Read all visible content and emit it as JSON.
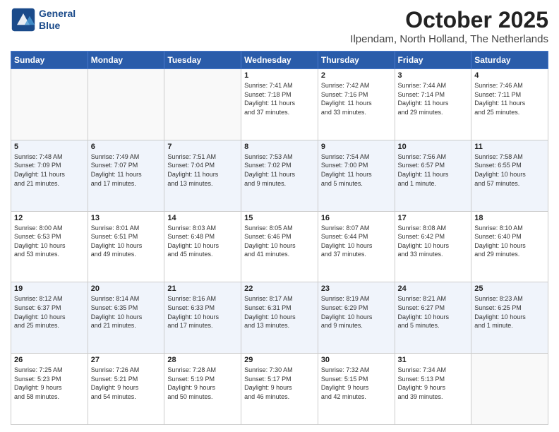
{
  "header": {
    "logo_line1": "General",
    "logo_line2": "Blue",
    "month": "October 2025",
    "location": "Ilpendam, North Holland, The Netherlands"
  },
  "days_of_week": [
    "Sunday",
    "Monday",
    "Tuesday",
    "Wednesday",
    "Thursday",
    "Friday",
    "Saturday"
  ],
  "weeks": [
    [
      {
        "day": "",
        "info": ""
      },
      {
        "day": "",
        "info": ""
      },
      {
        "day": "",
        "info": ""
      },
      {
        "day": "1",
        "info": "Sunrise: 7:41 AM\nSunset: 7:18 PM\nDaylight: 11 hours\nand 37 minutes."
      },
      {
        "day": "2",
        "info": "Sunrise: 7:42 AM\nSunset: 7:16 PM\nDaylight: 11 hours\nand 33 minutes."
      },
      {
        "day": "3",
        "info": "Sunrise: 7:44 AM\nSunset: 7:14 PM\nDaylight: 11 hours\nand 29 minutes."
      },
      {
        "day": "4",
        "info": "Sunrise: 7:46 AM\nSunset: 7:11 PM\nDaylight: 11 hours\nand 25 minutes."
      }
    ],
    [
      {
        "day": "5",
        "info": "Sunrise: 7:48 AM\nSunset: 7:09 PM\nDaylight: 11 hours\nand 21 minutes."
      },
      {
        "day": "6",
        "info": "Sunrise: 7:49 AM\nSunset: 7:07 PM\nDaylight: 11 hours\nand 17 minutes."
      },
      {
        "day": "7",
        "info": "Sunrise: 7:51 AM\nSunset: 7:04 PM\nDaylight: 11 hours\nand 13 minutes."
      },
      {
        "day": "8",
        "info": "Sunrise: 7:53 AM\nSunset: 7:02 PM\nDaylight: 11 hours\nand 9 minutes."
      },
      {
        "day": "9",
        "info": "Sunrise: 7:54 AM\nSunset: 7:00 PM\nDaylight: 11 hours\nand 5 minutes."
      },
      {
        "day": "10",
        "info": "Sunrise: 7:56 AM\nSunset: 6:57 PM\nDaylight: 11 hours\nand 1 minute."
      },
      {
        "day": "11",
        "info": "Sunrise: 7:58 AM\nSunset: 6:55 PM\nDaylight: 10 hours\nand 57 minutes."
      }
    ],
    [
      {
        "day": "12",
        "info": "Sunrise: 8:00 AM\nSunset: 6:53 PM\nDaylight: 10 hours\nand 53 minutes."
      },
      {
        "day": "13",
        "info": "Sunrise: 8:01 AM\nSunset: 6:51 PM\nDaylight: 10 hours\nand 49 minutes."
      },
      {
        "day": "14",
        "info": "Sunrise: 8:03 AM\nSunset: 6:48 PM\nDaylight: 10 hours\nand 45 minutes."
      },
      {
        "day": "15",
        "info": "Sunrise: 8:05 AM\nSunset: 6:46 PM\nDaylight: 10 hours\nand 41 minutes."
      },
      {
        "day": "16",
        "info": "Sunrise: 8:07 AM\nSunset: 6:44 PM\nDaylight: 10 hours\nand 37 minutes."
      },
      {
        "day": "17",
        "info": "Sunrise: 8:08 AM\nSunset: 6:42 PM\nDaylight: 10 hours\nand 33 minutes."
      },
      {
        "day": "18",
        "info": "Sunrise: 8:10 AM\nSunset: 6:40 PM\nDaylight: 10 hours\nand 29 minutes."
      }
    ],
    [
      {
        "day": "19",
        "info": "Sunrise: 8:12 AM\nSunset: 6:37 PM\nDaylight: 10 hours\nand 25 minutes."
      },
      {
        "day": "20",
        "info": "Sunrise: 8:14 AM\nSunset: 6:35 PM\nDaylight: 10 hours\nand 21 minutes."
      },
      {
        "day": "21",
        "info": "Sunrise: 8:16 AM\nSunset: 6:33 PM\nDaylight: 10 hours\nand 17 minutes."
      },
      {
        "day": "22",
        "info": "Sunrise: 8:17 AM\nSunset: 6:31 PM\nDaylight: 10 hours\nand 13 minutes."
      },
      {
        "day": "23",
        "info": "Sunrise: 8:19 AM\nSunset: 6:29 PM\nDaylight: 10 hours\nand 9 minutes."
      },
      {
        "day": "24",
        "info": "Sunrise: 8:21 AM\nSunset: 6:27 PM\nDaylight: 10 hours\nand 5 minutes."
      },
      {
        "day": "25",
        "info": "Sunrise: 8:23 AM\nSunset: 6:25 PM\nDaylight: 10 hours\nand 1 minute."
      }
    ],
    [
      {
        "day": "26",
        "info": "Sunrise: 7:25 AM\nSunset: 5:23 PM\nDaylight: 9 hours\nand 58 minutes."
      },
      {
        "day": "27",
        "info": "Sunrise: 7:26 AM\nSunset: 5:21 PM\nDaylight: 9 hours\nand 54 minutes."
      },
      {
        "day": "28",
        "info": "Sunrise: 7:28 AM\nSunset: 5:19 PM\nDaylight: 9 hours\nand 50 minutes."
      },
      {
        "day": "29",
        "info": "Sunrise: 7:30 AM\nSunset: 5:17 PM\nDaylight: 9 hours\nand 46 minutes."
      },
      {
        "day": "30",
        "info": "Sunrise: 7:32 AM\nSunset: 5:15 PM\nDaylight: 9 hours\nand 42 minutes."
      },
      {
        "day": "31",
        "info": "Sunrise: 7:34 AM\nSunset: 5:13 PM\nDaylight: 9 hours\nand 39 minutes."
      },
      {
        "day": "",
        "info": ""
      }
    ]
  ]
}
